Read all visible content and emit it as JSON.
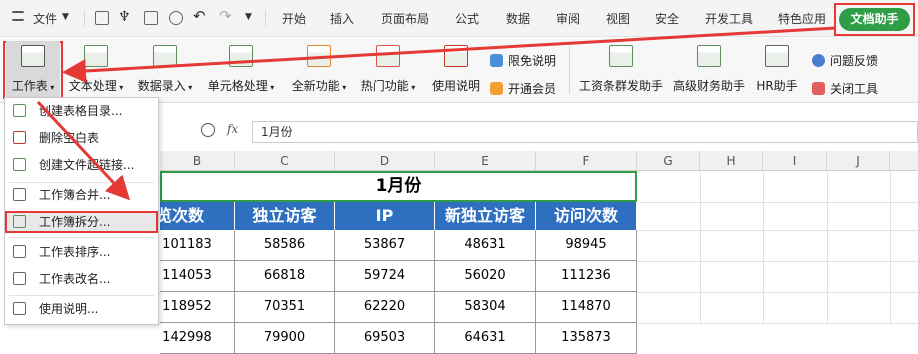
{
  "menubar": {
    "file": "文件",
    "tabs": [
      "开始",
      "插入",
      "页面布局",
      "公式",
      "数据",
      "审阅",
      "视图",
      "安全",
      "开发工具",
      "特色应用"
    ],
    "doc_helper": "文档助手"
  },
  "ribbon": {
    "worksheet": "工作表",
    "text_proc": "文本处理",
    "data_entry": "数据录入",
    "cell_proc": "单元格处理",
    "new_func": "全新功能",
    "hot_func": "热门功能",
    "instructions": "使用说明",
    "free_desc": "限免说明",
    "open_member": "开通会员",
    "salary_helper": "工资条群发助手",
    "finance_helper": "高级财务助手",
    "hr_helper": "HR助手",
    "feedback": "问题反馈",
    "close_tool": "关闭工具"
  },
  "formula": {
    "fx": "fx",
    "value": "1月份"
  },
  "columns": [
    "B",
    "C",
    "D",
    "E",
    "F",
    "G",
    "H",
    "I",
    "J"
  ],
  "sheet": {
    "title": "1月份",
    "headers": [
      "浏览次数",
      "独立访客",
      "IP",
      "新独立访客",
      "访问次数"
    ],
    "rows": [
      [
        "101183",
        "58586",
        "53867",
        "48631",
        "98945"
      ],
      [
        "114053",
        "66818",
        "59724",
        "56020",
        "111236"
      ],
      [
        "118952",
        "70351",
        "62220",
        "58304",
        "114870"
      ],
      [
        "142998",
        "79900",
        "69503",
        "64631",
        "135873"
      ]
    ]
  },
  "dropdown": {
    "items": [
      "创建表格目录...",
      "删除空白表",
      "创建文件超链接...",
      "工作簿合并...",
      "工作簿拆分...",
      "工作表排序...",
      "工作表改名...",
      "使用说明..."
    ]
  },
  "colors": {
    "accent": "#2e9d46",
    "header_blue": "#2f6fbf",
    "highlight": "#e53935"
  }
}
